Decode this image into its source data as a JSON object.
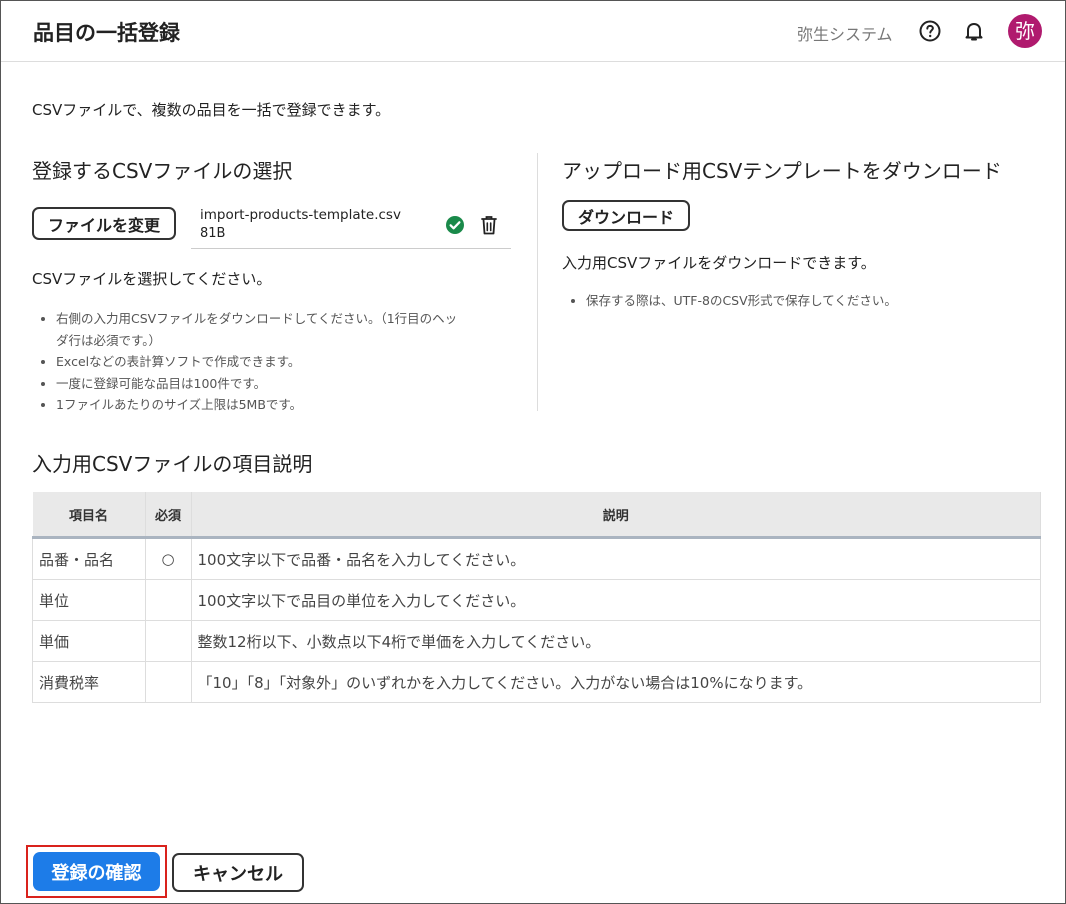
{
  "header": {
    "title": "品目の一括登録",
    "company": "弥生システム",
    "avatar_initial": "弥"
  },
  "intro": "CSVファイルで、複数の品目を一括で登録できます。",
  "upload": {
    "title": "登録するCSVファイルの選択",
    "change_button": "ファイルを変更",
    "file_name": "import-products-template.csv",
    "file_size": "81B",
    "prompt": "CSVファイルを選択してください。",
    "notes": [
      "右側の入力用CSVファイルをダウンロードしてください。（1行目のヘッ",
      "ダ行は必須です。）",
      "Excelなどの表計算ソフトで作成できます。",
      "一度に登録可能な品目は100件です。",
      "1ファイルあたりのサイズ上限は5MBです。"
    ]
  },
  "download": {
    "title": "アップロード用CSVテンプレートをダウンロード",
    "button": "ダウンロード",
    "description": "入力用CSVファイルをダウンロードできます。",
    "notes": [
      "保存する際は、UTF-8のCSV形式で保存してください。"
    ]
  },
  "spec": {
    "title": "入力用CSVファイルの項目説明",
    "headers": [
      "項目名",
      "必須",
      "説明"
    ],
    "rows": [
      {
        "name": "品番・品名",
        "required": "○",
        "desc": "100文字以下で品番・品名を入力してください。"
      },
      {
        "name": "単位",
        "required": "",
        "desc": "100文字以下で品目の単位を入力してください。"
      },
      {
        "name": "単価",
        "required": "",
        "desc": "整数12桁以下、小数点以下4桁で単価を入力してください。"
      },
      {
        "name": "消費税率",
        "required": "",
        "desc": "「10」「8」「対象外」のいずれかを入力してください。入力がない場合は10%になります。"
      }
    ]
  },
  "footer": {
    "confirm_button": "登録の確認",
    "cancel_button": "キャンセル"
  },
  "colors": {
    "primary": "#1d7ce8",
    "avatar": "#b01a6e",
    "success": "#1a8a4a",
    "highlight": "#d9221c"
  },
  "icons": {
    "help": "help-circle-icon",
    "notification": "bell-icon",
    "file_ok": "check-circle-icon",
    "delete": "trash-icon"
  }
}
